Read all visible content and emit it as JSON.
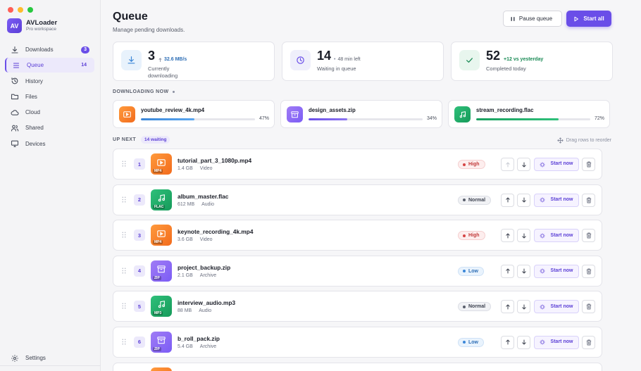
{
  "app": {
    "name": "AVLoader",
    "workspace": "Pro workspace",
    "logo_text": "AV",
    "colors": {
      "accent": "#6a4ee8",
      "close": "#ff5f57",
      "minimize": "#febc2e",
      "maximize": "#28c840"
    }
  },
  "sidebar": {
    "items": [
      {
        "label": "Downloads",
        "icon": "download-icon",
        "badge": "3",
        "active": false
      },
      {
        "label": "Queue",
        "icon": "list-icon",
        "badge": "14",
        "active": true
      },
      {
        "label": "History",
        "icon": "history-icon",
        "badge": "",
        "active": false
      },
      {
        "label": "Files",
        "icon": "folder-icon",
        "badge": "",
        "active": false
      },
      {
        "label": "Cloud",
        "icon": "cloud-icon",
        "badge": "",
        "active": false
      },
      {
        "label": "Shared",
        "icon": "users-icon",
        "badge": "",
        "active": false
      },
      {
        "label": "Devices",
        "icon": "monitor-icon",
        "badge": "",
        "active": false
      }
    ],
    "settings_label": "Settings"
  },
  "header": {
    "title": "Queue",
    "subtitle": "Manage pending downloads.",
    "pause_label": "Pause queue",
    "start_all_label": "Start all"
  },
  "stats": [
    {
      "value": "3",
      "extra": "32.6 MB/s",
      "label": "Currently downloading",
      "color": "#2f6fb6",
      "icon": "download-icon"
    },
    {
      "value": "14",
      "extra": "48 min left",
      "label": "Waiting in queue",
      "color": "#5a5f6c",
      "icon": "clock-icon"
    },
    {
      "value": "52",
      "extra": "+12 vs yesterday",
      "label": "Completed today",
      "color": "#1a8a55",
      "icon": "check-icon"
    }
  ],
  "downloading": {
    "title": "DOWNLOADING NOW",
    "items": [
      {
        "name": "youtube_review_4k.mp4",
        "percent": 47,
        "pct_label": "47%",
        "kind": "video"
      },
      {
        "name": "design_assets.zip",
        "percent": 34,
        "pct_label": "34%",
        "kind": "archive"
      },
      {
        "name": "stream_recording.flac",
        "percent": 72,
        "pct_label": "72%",
        "kind": "audio"
      }
    ]
  },
  "upnext": {
    "title": "UP NEXT",
    "badge": "14 waiting",
    "drag_hint": "Drag rows to reorder",
    "start_now_label": "Start now",
    "rows": [
      {
        "pos": "1",
        "name": "tutorial_part_3_1080p.mp4",
        "size": "1.4 GB",
        "type": "Video",
        "tag": "MP4",
        "kind": "video",
        "priority": "High"
      },
      {
        "pos": "2",
        "name": "album_master.flac",
        "size": "612 MB",
        "type": "Audio",
        "tag": "FLAC",
        "kind": "audio",
        "priority": "Normal"
      },
      {
        "pos": "3",
        "name": "keynote_recording_4k.mp4",
        "size": "3.6 GB",
        "type": "Video",
        "tag": "MP4",
        "kind": "video",
        "priority": "High"
      },
      {
        "pos": "4",
        "name": "project_backup.zip",
        "size": "2.1 GB",
        "type": "Archive",
        "tag": "ZIP",
        "kind": "archive",
        "priority": "Low"
      },
      {
        "pos": "5",
        "name": "interview_audio.mp3",
        "size": "88 MB",
        "type": "Audio",
        "tag": "MP3",
        "kind": "audio",
        "priority": "Normal"
      },
      {
        "pos": "6",
        "name": "b_roll_pack.zip",
        "size": "5.4 GB",
        "type": "Archive",
        "tag": "ZIP",
        "kind": "archive",
        "priority": "Low"
      }
    ]
  }
}
